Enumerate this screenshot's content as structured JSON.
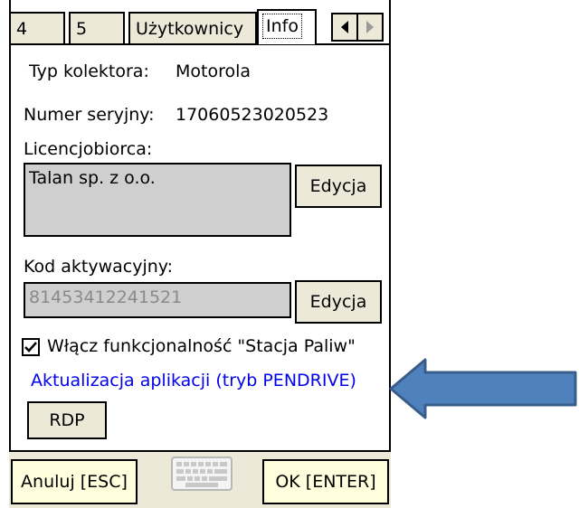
{
  "tabs": [
    {
      "label": "4",
      "active": false
    },
    {
      "label": "5",
      "active": false
    },
    {
      "label": "Użytkownicy",
      "active": false
    },
    {
      "label": "Info",
      "active": true
    }
  ],
  "info": {
    "collector_type_label": "Typ kolektora:",
    "collector_type_value": "Motorola",
    "serial_label": "Numer seryjny:",
    "serial_value": "17060523020523",
    "licensee_label": "Licencjobiorca:",
    "licensee_value": "Talan sp. z o.o.",
    "activation_label": "Kod aktywacyjny:",
    "activation_value": "81453412241521",
    "edit_label": "Edycja"
  },
  "fuel_station": {
    "checked": true,
    "label": "Włącz funkcjonalność \"Stacja Paliw\""
  },
  "update_link": "Aktualizacja aplikacji (tryb PENDRIVE)",
  "rdp_label": "RDP",
  "bottom": {
    "cancel_label": "Anuluj [ESC]",
    "ok_label": "OK [ENTER]"
  },
  "colors": {
    "arrow_fill": "#4f81bd",
    "arrow_stroke": "#385d8a",
    "link": "#0000ee",
    "tab_bg": "#ece9d8",
    "bottom_button_bg": "#ffffdd"
  },
  "icons": [
    "scroll-left-icon",
    "scroll-right-icon",
    "checkmark-icon",
    "keyboard-icon",
    "blue-arrow"
  ]
}
